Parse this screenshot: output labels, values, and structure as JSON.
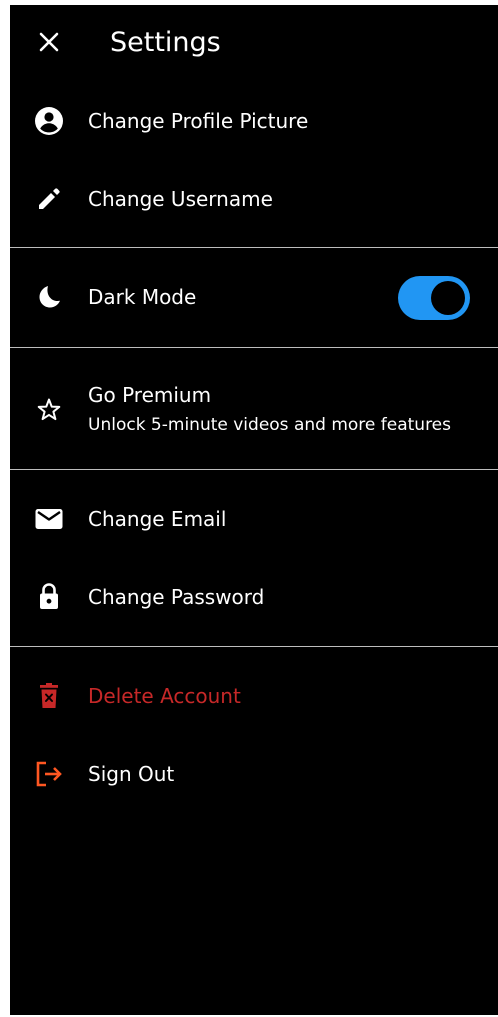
{
  "header": {
    "close_icon": "close-icon",
    "title": "Settings"
  },
  "items": {
    "profile_picture": {
      "label": "Change Profile Picture",
      "icon": "account-circle-icon"
    },
    "username": {
      "label": "Change Username",
      "icon": "pencil-icon"
    },
    "dark_mode": {
      "label": "Dark Mode",
      "icon": "moon-icon",
      "enabled": true
    },
    "premium": {
      "label": "Go Premium",
      "sublabel": "Unlock 5-minute videos and more features",
      "icon": "star-outline-icon"
    },
    "email": {
      "label": "Change Email",
      "icon": "mail-icon"
    },
    "password": {
      "label": "Change Password",
      "icon": "lock-icon"
    },
    "delete": {
      "label": "Delete Account",
      "icon": "trash-icon"
    },
    "signout": {
      "label": "Sign Out",
      "icon": "logout-icon"
    }
  },
  "colors": {
    "background": "#000000",
    "text": "#ffffff",
    "toggle_on": "#2196f3",
    "danger": "#c62828",
    "signout_icon": "#ff5722",
    "divider": "#bdbdbd"
  }
}
